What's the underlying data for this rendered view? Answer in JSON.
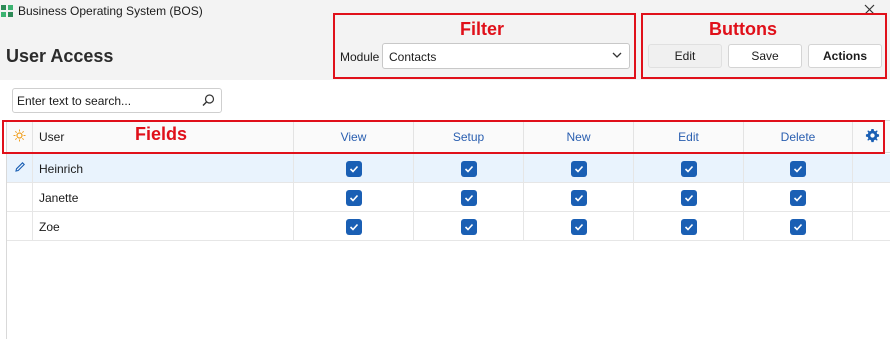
{
  "window": {
    "title": "Business Operating System (BOS)",
    "app_icon": "bos-logo-icon",
    "close_icon": "close-icon"
  },
  "page": {
    "title": "User Access"
  },
  "filter": {
    "label": "Module",
    "selected": "Contacts",
    "chevron_icon": "chevron-down-icon"
  },
  "toolbar": {
    "edit_label": "Edit",
    "save_label": "Save",
    "actions_label": "Actions"
  },
  "search": {
    "placeholder": "Enter text to search...",
    "value": "",
    "icon": "search-icon"
  },
  "annotations": {
    "filter": "Filter",
    "buttons": "Buttons",
    "fields": "Fields"
  },
  "grid": {
    "columns": [
      "User",
      "View",
      "Setup",
      "New",
      "Edit",
      "Delete"
    ],
    "header_icon_left": "sun-icon",
    "header_icon_right": "gear-icon",
    "row_edit_icon": "pencil-icon",
    "rows": [
      {
        "user": "Heinrich",
        "view": true,
        "setup": true,
        "new": true,
        "edit": true,
        "delete": true,
        "selected": true
      },
      {
        "user": "Janette",
        "view": true,
        "setup": true,
        "new": true,
        "edit": true,
        "delete": true,
        "selected": false
      },
      {
        "user": "Zoe",
        "view": true,
        "setup": true,
        "new": true,
        "edit": true,
        "delete": true,
        "selected": false
      }
    ]
  },
  "colors": {
    "accent": "#1a5fb4",
    "header_text": "#2a5fb0",
    "annotation": "#e0101a",
    "selected_row": "#e9f3fd",
    "sun": "#f0a020"
  }
}
